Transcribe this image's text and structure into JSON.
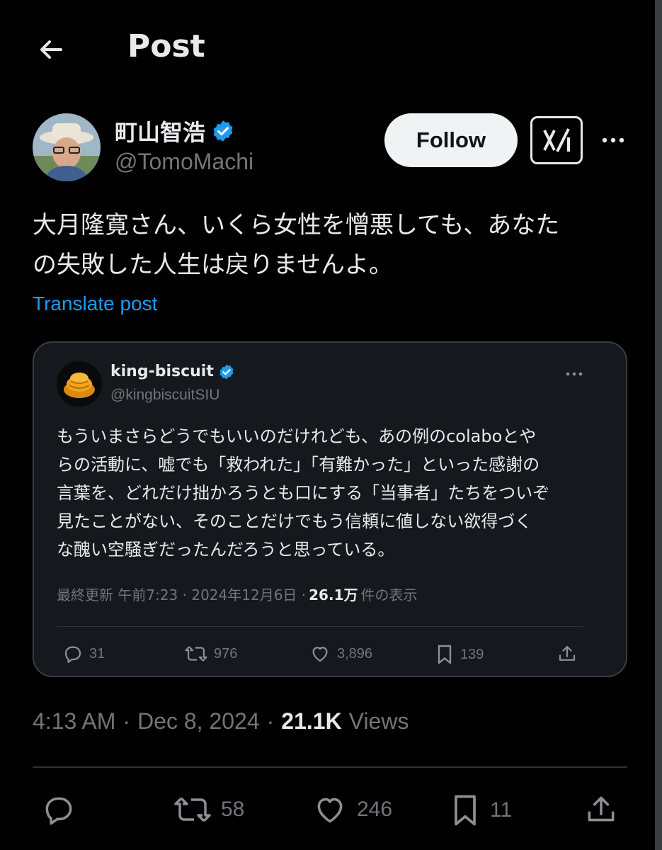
{
  "header": {
    "title": "Post",
    "back_icon": "back-arrow-icon"
  },
  "post": {
    "author": {
      "name": "町山智浩",
      "handle": "@TomoMachi",
      "verified": true,
      "verified_color": "#1d9bf0"
    },
    "follow_label": "Follow",
    "text_lines": [
      "大月隆寛さん、いくら女性を憎悪しても、あなた",
      "の失敗した人生は戻りませんよ。"
    ],
    "translate_label": "Translate post",
    "time": "4:13 AM",
    "date": "Dec 8, 2024",
    "views_count": "21.1K",
    "views_label": "Views",
    "stats": {
      "replies": "",
      "reposts": "58",
      "likes": "246",
      "bookmarks": "11"
    }
  },
  "quote": {
    "author": {
      "name": "king-biscuit",
      "handle": "@kingbiscuitSIU",
      "verified": true
    },
    "text_lines": [
      "もういまさらどうでもいいのだけれども、あの例のcolaboとや",
      "らの活動に、嘘でも「救われた」「有難かった」といった感謝の",
      "言葉を、どれだけ拙かろうとも口にする「当事者」たちをついぞ",
      "見たことがない、そのことだけでもう信頼に値しない欲得づく",
      "な醜い空騒ぎだったんだろうと思っている。"
    ],
    "meta_prefix": "最終更新 午前7:23 · 2024年12月6日 ·",
    "views_count": "26.1万",
    "views_label": "件の表示",
    "stats": {
      "replies": "31",
      "reposts": "976",
      "likes": "3,896",
      "bookmarks": "139"
    }
  },
  "colors": {
    "background": "#000000",
    "accent": "#1d9bf0",
    "muted": "#71767b",
    "text": "#e7e9ea"
  }
}
